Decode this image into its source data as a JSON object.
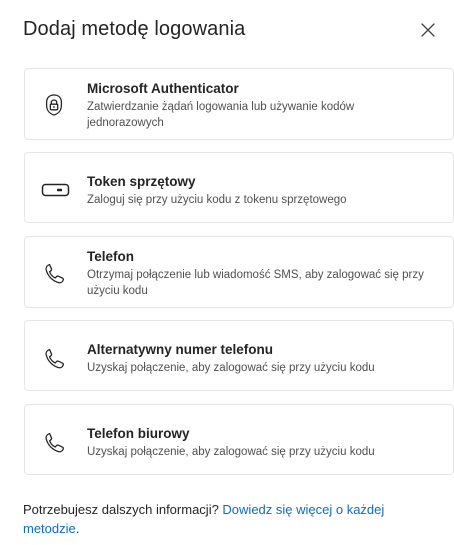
{
  "dialog": {
    "title": "Dodaj metodę logowania",
    "close_icon": "close-icon"
  },
  "methods": [
    {
      "icon": "authenticator-lock-icon",
      "name": "Microsoft Authenticator",
      "description": "Zatwierdzanie żądań logowania lub używanie kodów jednorazowych"
    },
    {
      "icon": "hardware-token-icon",
      "name": "Token sprzętowy",
      "description": "Zaloguj się przy użyciu kodu z tokenu sprzętowego"
    },
    {
      "icon": "phone-icon",
      "name": "Telefon",
      "description": "Otrzymaj połączenie lub wiadomość SMS, aby zalogować się przy użyciu kodu"
    },
    {
      "icon": "phone-icon",
      "name": "Alternatywny numer telefonu",
      "description": "Uzyskaj połączenie, aby zalogować się przy użyciu kodu"
    },
    {
      "icon": "phone-icon",
      "name": "Telefon biurowy",
      "description": "Uzyskaj połączenie, aby zalogować się przy użyciu kodu"
    }
  ],
  "footer": {
    "text": "Potrzebujesz dalszych informacji? ",
    "link": "Dowiedz się więcej o każdej metodzie",
    "suffix": "."
  },
  "colors": {
    "link": "#0f6cbd",
    "border": "#e6e6e6",
    "text": "#242424",
    "secondary_text": "#505050"
  }
}
